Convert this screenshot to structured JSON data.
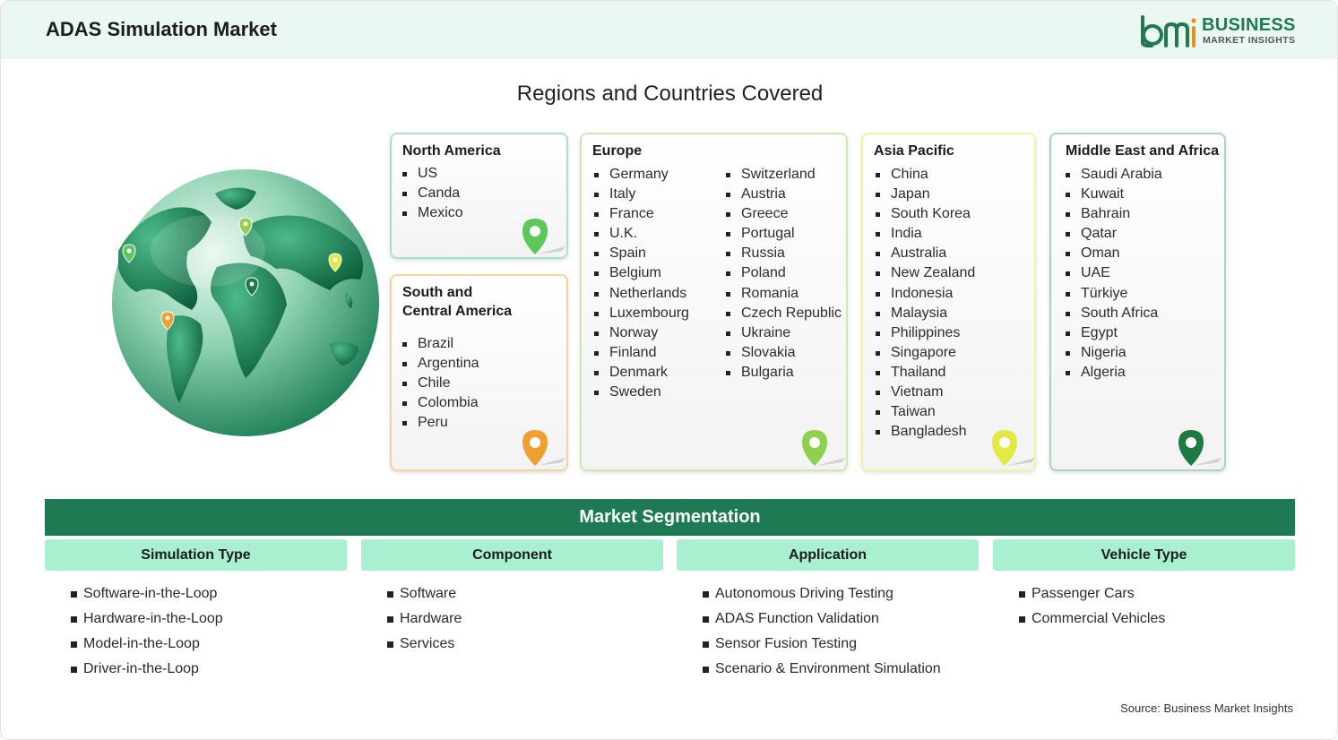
{
  "header": {
    "title": "ADAS Simulation Market"
  },
  "logo": {
    "line1": "BUSINESS",
    "line2": "MARKET INSIGHTS",
    "color": "#1f7a4d"
  },
  "regions_title": "Regions and Countries Covered",
  "regions": {
    "north_america": {
      "title": "North America",
      "countries": [
        "US",
        "Canda",
        "Mexico"
      ],
      "accent": "#5cc85c"
    },
    "south_central_america": {
      "title_line1": "South and",
      "title_line2": "Central America",
      "countries": [
        "Brazil",
        "Argentina",
        "Chile",
        "Colombia",
        "Peru"
      ],
      "accent": "#f0a030"
    },
    "europe": {
      "title": "Europe",
      "countries_col1": [
        "Germany",
        "Italy",
        "France",
        "U.K.",
        "Spain",
        "Belgium",
        "Netherlands",
        "Luxembourg",
        "Norway",
        "Finland",
        "Denmark",
        "Sweden"
      ],
      "countries_col2": [
        "Switzerland",
        "Austria",
        "Greece",
        "Portugal",
        "Russia",
        "Poland",
        "Romania",
        "Czech Republic",
        "Ukraine",
        "Slovakia",
        "Bulgaria"
      ],
      "accent": "#8fd14f"
    },
    "asia_pacific": {
      "title": "Asia Pacific",
      "countries": [
        "China",
        "Japan",
        "South Korea",
        "India",
        "Australia",
        "New Zealand",
        "Indonesia",
        "Malaysia",
        "Philippines",
        "Singapore",
        "Thailand",
        "Vietnam",
        "Taiwan",
        "Bangladesh"
      ],
      "accent": "#e3e845"
    },
    "middle_east_africa": {
      "title": "Middle East and Africa",
      "countries": [
        "Saudi Arabia",
        "Kuwait",
        "Bahrain",
        "Qatar",
        "Oman",
        "UAE",
        "Türkiye",
        "South Africa",
        "Egypt",
        "Nigeria",
        "Algeria"
      ],
      "accent": "#1d7a40"
    }
  },
  "segmentation": {
    "title": "Market Segmentation",
    "columns": [
      {
        "heading": "Simulation Type",
        "items": [
          "Software-in-the-Loop",
          "Hardware-in-the-Loop",
          "Model-in-the-Loop",
          "Driver-in-the-Loop"
        ]
      },
      {
        "heading": "Component",
        "items": [
          "Software",
          "Hardware",
          "Services"
        ]
      },
      {
        "heading": "Application",
        "items": [
          "Autonomous Driving Testing",
          "ADAS Function Validation",
          "Sensor Fusion Testing",
          "Scenario & Environment Simulation"
        ]
      },
      {
        "heading": "Vehicle Type",
        "items": [
          "Passenger Cars",
          "Commercial Vehicles"
        ]
      }
    ]
  },
  "source": "Source: Business Market Insights",
  "icons": [
    "globe-icon",
    "location-pin-icon",
    "logo-mark-icon"
  ]
}
